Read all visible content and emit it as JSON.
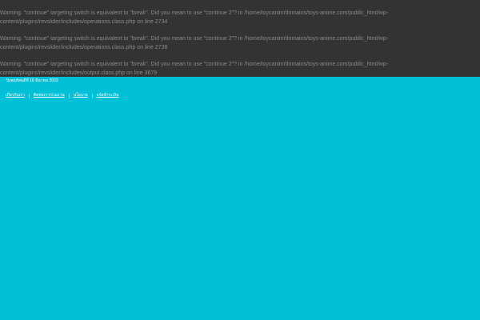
{
  "warnings": [
    "Warning: \"continue\" targeting switch is equivalent to \"break\". Did you mean to use \"continue 2\"? in /home/toycanim/domains/toys-anime.com/public_html/wp-content/plugins/revslider/includes/operations.class.php on line 2734",
    "Warning: \"continue\" targeting switch is equivalent to \"break\". Did you mean to use \"continue 2\"? in /home/toycanim/domains/toys-anime.com/public_html/wp-content/plugins/revslider/includes/operations.class.php on line 2738",
    "Warning: \"continue\" targeting switch is equivalent to \"break\". Did you mean to use \"continue 2\"? in /home/toycanim/domains/toys-anime.com/public_html/wp-content/plugins/revslider/includes/output.class.php on line 3679"
  ],
  "header": {
    "date": "วันพฤหัสบดีที่ 16 มีนาคม 2023"
  },
  "nav": {
    "items": [
      "เกี่ยวกับเรา",
      "ติดต่อเรา/ร่วมงาน",
      "นโยบาย",
      "แจ้งชำระเงิน"
    ]
  },
  "colors": {
    "warning_bg": "#333333",
    "warning_text": "#8a8a8a",
    "page_bg": "#00c0d8"
  }
}
